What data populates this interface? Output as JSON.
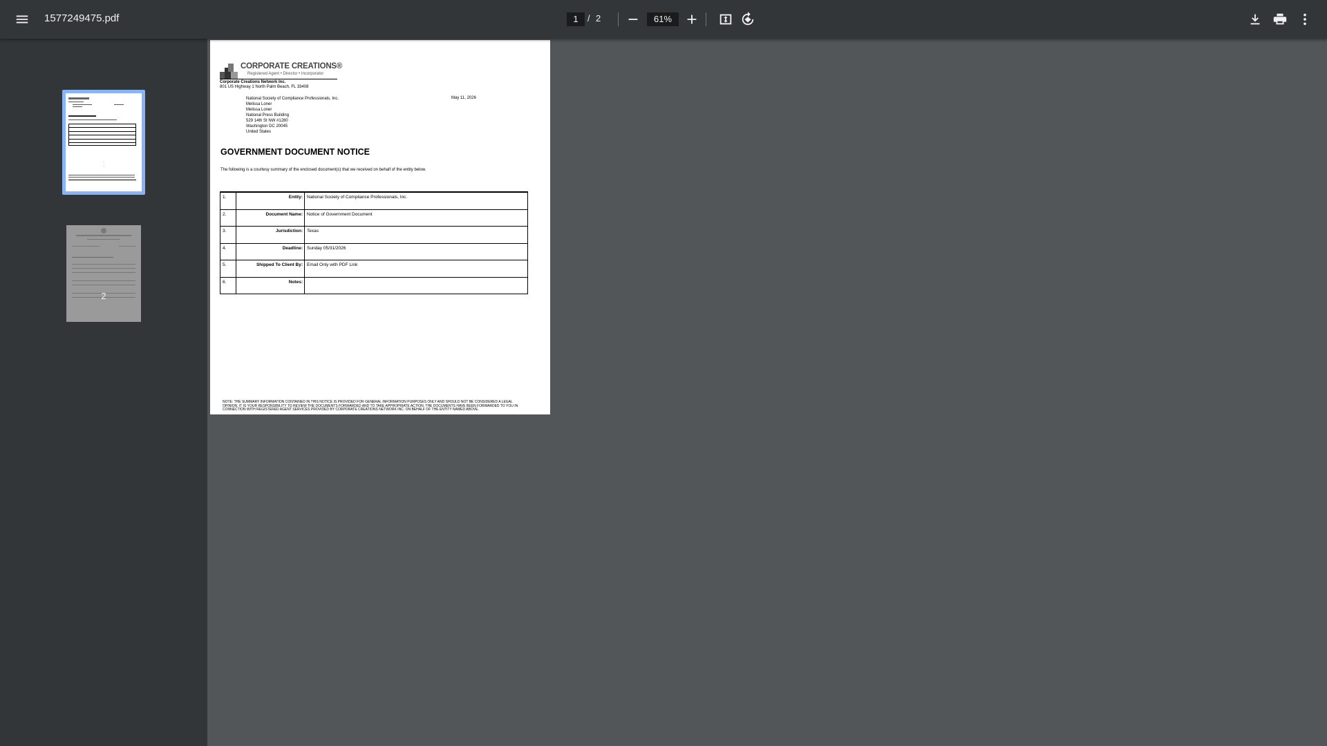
{
  "toolbar": {
    "file_name": "1577249475.pdf",
    "current_page": "1",
    "page_separator": "/",
    "total_pages": "2",
    "zoom": "61%"
  },
  "sidebar": {
    "thumbnails": [
      {
        "label": "1",
        "selected": true
      },
      {
        "label": "2",
        "selected": false
      }
    ]
  },
  "document": {
    "logo": {
      "name": "CORPORATE CREATIONS®",
      "tagline": "Registered Agent • Director • Incorporator"
    },
    "company_name": "Corporate Creations Network Inc.",
    "company_address": "801 US Highway 1 North Palm Beach, FL 33408",
    "recipient": [
      "National Society of Compliance Professionals, Inc.",
      "Melissa Loner",
      "Melissa Loner",
      "National Press Building",
      "529 14th St NW #1280",
      "Washington DC 20045",
      "United States"
    ],
    "date": "May 11, 2026",
    "title": "GOVERNMENT DOCUMENT NOTICE",
    "intro": "The following is a courtesy summary of the enclosed document(s) that we received on behalf of the entity below.",
    "summary_rows": [
      {
        "num": "1.",
        "label": "Entity:",
        "value": "National Society of Compliance Professionals, Inc."
      },
      {
        "num": "2.",
        "label": "Document Name:",
        "value": "Notice of Government Document"
      },
      {
        "num": "3.",
        "label": "Jurisdiction:",
        "value": "Texas"
      },
      {
        "num": "4.",
        "label": "Deadline:",
        "value": "Sunday 05/31/2026"
      },
      {
        "num": "5.",
        "label": "Shipped To Client By:",
        "value": "Email Only with PDF Link"
      },
      {
        "num": "6.",
        "label": "Notes:",
        "value": ""
      }
    ],
    "footnote": "NOTE: THE SUMMARY INFORMATION CONTAINED IN THIS NOTICE IS PROVIDED FOR GENERAL INFORMATION PURPOSES ONLY AND SHOULD NOT BE CONSIDERED A LEGAL OPINION. IT IS YOUR RESPONSIBILITY TO REVIEW THE DOCUMENTS FORWARDED AND TO TAKE APPROPRIATE ACTION. THE DOCUMENTS HAVE BEEN FORWARDED TO YOU IN CONNECTION WITH REGISTERED AGENT SERVICES PROVIDED BY CORPORATE CREATIONS NETWORK INC. ON BEHALF OF THE ENTITY NAMED ABOVE."
  },
  "colors": {
    "toolbar_bg": "#323639",
    "viewer_bg": "#525659",
    "thumb_selected": "#8ab4f8"
  },
  "icons": [
    "menu-icon",
    "zoom-out-icon",
    "zoom-in-icon",
    "fit-page-icon",
    "rotate-icon",
    "download-icon",
    "print-icon",
    "more-vert-icon"
  ]
}
